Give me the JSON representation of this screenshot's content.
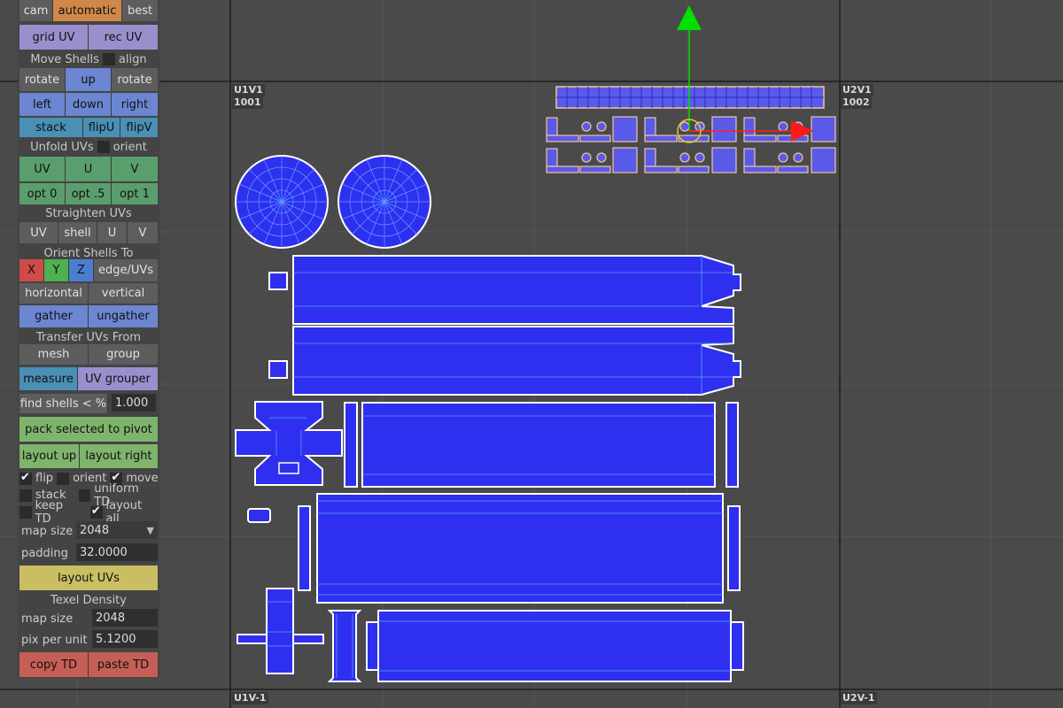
{
  "viewport": {
    "tiles": {
      "u1v1": "U1V1",
      "u1v1_num": "1001",
      "u2v1": "U2V1",
      "u2v1_num": "1002",
      "u1vm1": "U1V-1",
      "u2vm1": "U2V-1"
    },
    "colors": {
      "background": "#4a4a4a",
      "shell_fill": "#2f2ff0",
      "shell_edge": "#ffffff",
      "grid_line": "#1c1c1c"
    }
  },
  "panel": {
    "top": {
      "cam": "cam",
      "automatic": "automatic",
      "best": "best"
    },
    "grid_uv": "grid UV",
    "rec_uv": "rec UV",
    "move_shells": "Move Shells",
    "align": "align",
    "rotate_l": "rotate",
    "up": "up",
    "rotate_r": "rotate",
    "left": "left",
    "down": "down",
    "right": "right",
    "stack": "stack",
    "flipU": "flipU",
    "flipV": "flipV",
    "unfold_uvs": "Unfold UVs",
    "orient": "orient",
    "uv": "UV",
    "u": "U",
    "v": "V",
    "opt0": "opt 0",
    "opt5": "opt .5",
    "opt1": "opt 1",
    "straighten": "Straighten UVs",
    "s_uv": "UV",
    "s_shell": "shell",
    "s_u": "U",
    "s_v": "V",
    "orient_shells": "Orient Shells To",
    "x": "X",
    "y": "Y",
    "z": "Z",
    "edge_uvs": "edge/UVs",
    "horizontal": "horizontal",
    "vertical": "vertical",
    "gather": "gather",
    "ungather": "ungather",
    "transfer": "Transfer UVs From",
    "mesh": "mesh",
    "group": "group",
    "measure": "measure",
    "uv_grouper": "UV grouper",
    "find_shells": "find shells < %",
    "find_value": "1.000",
    "pack": "pack selected to pivot",
    "layout_up": "layout up",
    "layout_right": "layout right",
    "opt_flip": "flip",
    "opt_orient": "orient",
    "opt_move": "move",
    "opt_stack": "stack",
    "opt_uniform": "uniform TD",
    "opt_keep": "keep TD",
    "opt_layout_all": "layout all",
    "map_size_label": "map size",
    "map_size_value": "2048",
    "padding_label": "padding",
    "padding_value": "32.0000",
    "layout_uvs": "layout UVs",
    "texel_density": "Texel Density",
    "td_map_size_label": "map size",
    "td_map_size_value": "2048",
    "pix_label": "pix per unit",
    "pix_value": "5.1200",
    "copy_td": "copy TD",
    "paste_td": "paste TD"
  }
}
